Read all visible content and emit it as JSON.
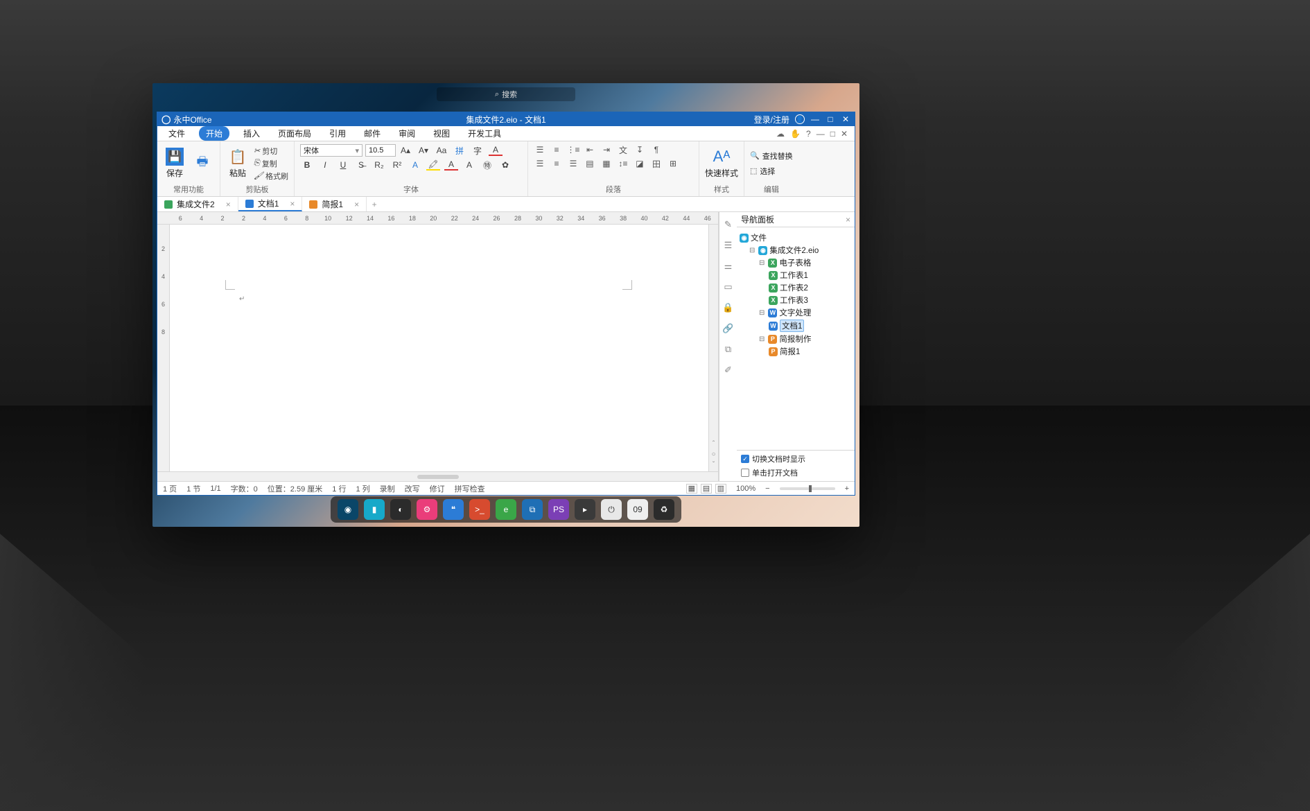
{
  "desktop": {
    "search_placeholder": "搜索"
  },
  "app": {
    "brand": "永中Office",
    "doc_title": "集成文件2.eio - 文档1",
    "login": "登录/注册"
  },
  "menu": {
    "items": [
      "文件",
      "开始",
      "插入",
      "页面布局",
      "引用",
      "邮件",
      "审阅",
      "视图",
      "开发工具"
    ],
    "active_index": 1
  },
  "ribbon": {
    "save": "保存",
    "common": "常用功能",
    "paste": "粘贴",
    "cut": "剪切",
    "copy": "复制",
    "format_painter": "格式刷",
    "clipboard": "剪贴板",
    "font_name": "宋体",
    "font_size": "10.5",
    "font_group": "字体",
    "para_group": "段落",
    "quick_style": "快速样式",
    "style_group": "样式",
    "find_replace": "查找替换",
    "select": "选择",
    "edit_group": "编辑"
  },
  "tabs": [
    {
      "icon": "g",
      "label": "集成文件2"
    },
    {
      "icon": "b",
      "label": "文档1"
    },
    {
      "icon": "o",
      "label": "简报1"
    }
  ],
  "active_tab": 1,
  "ruler_marks": [
    "6",
    "4",
    "2",
    "2",
    "4",
    "6",
    "8",
    "10",
    "12",
    "14",
    "16",
    "18",
    "20",
    "22",
    "24",
    "26",
    "28",
    "30",
    "32",
    "34",
    "36",
    "38",
    "40",
    "42",
    "44",
    "46"
  ],
  "nav": {
    "title": "导航面板",
    "root": "文件",
    "file": "集成文件2.eio",
    "spreadsheet": "电子表格",
    "sheets": [
      "工作表1",
      "工作表2",
      "工作表3"
    ],
    "wordproc": "文字处理",
    "doc": "文档1",
    "present": "简报制作",
    "slide": "简报1",
    "opt_switch": "切换文档时显示",
    "opt_single": "单击打开文档"
  },
  "status": {
    "page": "1 页",
    "section": "1 节",
    "pages": "1/1",
    "chars_label": "字数：",
    "chars": "0",
    "pos_label": "位置：",
    "pos": "2.59 厘米",
    "row": "1 行",
    "col": "1 列",
    "record": "录制",
    "overwrite": "改写",
    "revise": "修订",
    "spell": "拼写检查",
    "zoom": "100%"
  },
  "dock": {
    "apps": [
      {
        "name": "launcher",
        "bg": "#0a4668",
        "glyph": "◉"
      },
      {
        "name": "files",
        "bg": "#17a9c9",
        "glyph": "▮"
      },
      {
        "name": "media",
        "bg": "#2b2b2b",
        "glyph": "◐"
      },
      {
        "name": "settings",
        "bg": "#ea3d7a",
        "glyph": "⚙"
      },
      {
        "name": "office",
        "bg": "#2c7cd6",
        "glyph": "❝"
      },
      {
        "name": "terminal",
        "bg": "#d74b2f",
        "glyph": ">_"
      },
      {
        "name": "browser",
        "bg": "#3aa648",
        "glyph": "e"
      },
      {
        "name": "vscode",
        "bg": "#1f6fb5",
        "glyph": "⧉"
      },
      {
        "name": "phpstorm",
        "bg": "#7b3fb5",
        "glyph": "PS"
      },
      {
        "name": "plugin",
        "bg": "#3a3a3a",
        "glyph": "▸"
      },
      {
        "name": "power",
        "bg": "#e8e8e8",
        "glyph": "⏻"
      },
      {
        "name": "clock",
        "bg": "#efefef",
        "glyph": "09"
      },
      {
        "name": "trash",
        "bg": "#2b2b2b",
        "glyph": "♻"
      }
    ]
  }
}
